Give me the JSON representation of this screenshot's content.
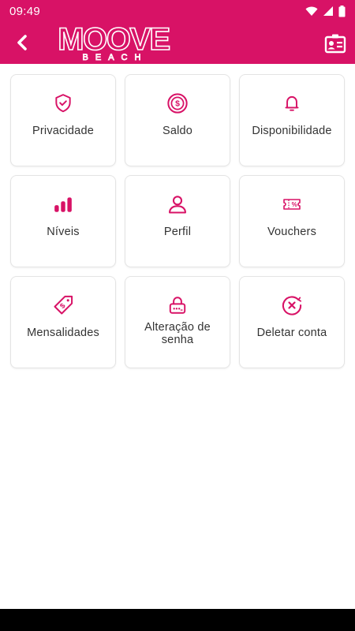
{
  "status_bar": {
    "time": "09:49"
  },
  "app_bar": {
    "logo_text": "MOOVE",
    "logo_subtext": "BEACH"
  },
  "colors": {
    "brand": "#d81266",
    "tile_border": "#e4e4e4",
    "label": "#333333"
  },
  "menu": {
    "items": [
      {
        "label": "Privacidade",
        "icon": "shield-check-icon"
      },
      {
        "label": "Saldo",
        "icon": "coin-icon"
      },
      {
        "label": "Disponibilidade",
        "icon": "bell-icon"
      },
      {
        "label": "Níveis",
        "icon": "levels-icon"
      },
      {
        "label": "Perfil",
        "icon": "user-icon"
      },
      {
        "label": "Vouchers",
        "icon": "voucher-icon"
      },
      {
        "label": "Mensalidades",
        "icon": "price-tag-icon"
      },
      {
        "label": "Alteração de senha",
        "icon": "password-lock-icon"
      },
      {
        "label": "Deletar conta",
        "icon": "delete-circle-icon"
      }
    ]
  }
}
